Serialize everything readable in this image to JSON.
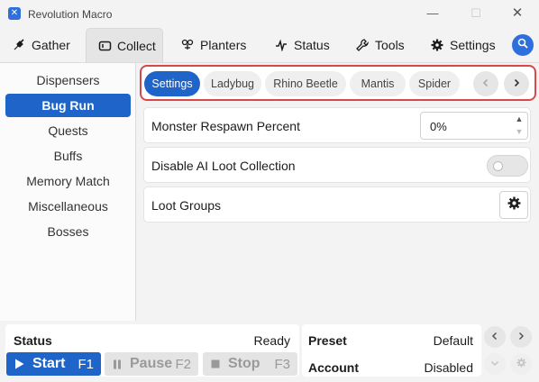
{
  "window": {
    "title": "Revolution Macro",
    "minimize_icon": "minimize-icon",
    "maximize_icon": "maximize-icon",
    "close_icon": "close-icon"
  },
  "tabs": [
    {
      "label": "Gather",
      "icon": "shovel-icon"
    },
    {
      "label": "Collect",
      "icon": "collect-icon",
      "active": true
    },
    {
      "label": "Planters",
      "icon": "planter-icon"
    },
    {
      "label": "Status",
      "icon": "pulse-icon"
    },
    {
      "label": "Tools",
      "icon": "wrench-icon"
    },
    {
      "label": "Settings",
      "icon": "gear-icon"
    }
  ],
  "search_icon": "search-icon",
  "sidebar": {
    "items": [
      {
        "label": "Dispensers"
      },
      {
        "label": "Bug Run",
        "active": true
      },
      {
        "label": "Quests"
      },
      {
        "label": "Buffs"
      },
      {
        "label": "Memory Match"
      },
      {
        "label": "Miscellaneous"
      },
      {
        "label": "Bosses"
      }
    ]
  },
  "subtabs": {
    "items": [
      "Settings",
      "Ladybug",
      "Rhino Beetle",
      "Mantis",
      "Spider"
    ],
    "active": "Settings",
    "prev_icon": "chevron-left-icon",
    "next_icon": "chevron-right-icon"
  },
  "settings": {
    "respawn": {
      "label": "Monster Respawn Percent",
      "value": "0%"
    },
    "ai_loot": {
      "label": "Disable AI Loot Collection",
      "enabled": false
    },
    "loot_groups": {
      "label": "Loot Groups",
      "icon": "gear-icon"
    }
  },
  "bottom": {
    "status_label": "Status",
    "status_value": "Ready",
    "preset_label": "Preset",
    "preset_value": "Default",
    "account_label": "Account",
    "account_value": "Disabled",
    "start": {
      "label": "Start",
      "key": "F1"
    },
    "pause": {
      "label": "Pause",
      "key": "F2"
    },
    "stop": {
      "label": "Stop",
      "key": "F3"
    }
  },
  "colors": {
    "accent": "#1f64c8",
    "highlight_border": "#d94848"
  }
}
